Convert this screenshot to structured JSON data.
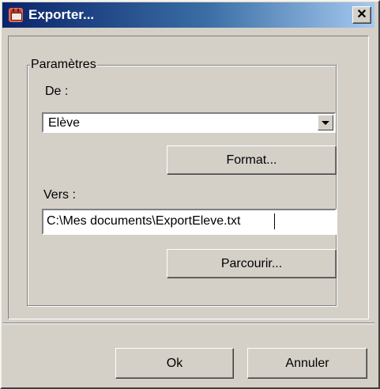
{
  "window": {
    "title": "Exporter...",
    "close_glyph": "✕"
  },
  "group": {
    "label": "Paramètres"
  },
  "from": {
    "label": "De :",
    "selected": "Elève"
  },
  "format_button": "Format...",
  "to": {
    "label": "Vers :",
    "value": "C:\\Mes documents\\ExportEleve.txt"
  },
  "browse_button": "Parcourir...",
  "footer": {
    "ok": "Ok",
    "cancel": "Annuler"
  },
  "icons": {
    "title_icon": "calendar-icon",
    "dropdown_icon": "chevron-down-icon",
    "close_icon": "close-icon"
  },
  "colors": {
    "titlebar_start": "#0a246a",
    "titlebar_end": "#a6caf0",
    "face": "#d4d0c8"
  }
}
